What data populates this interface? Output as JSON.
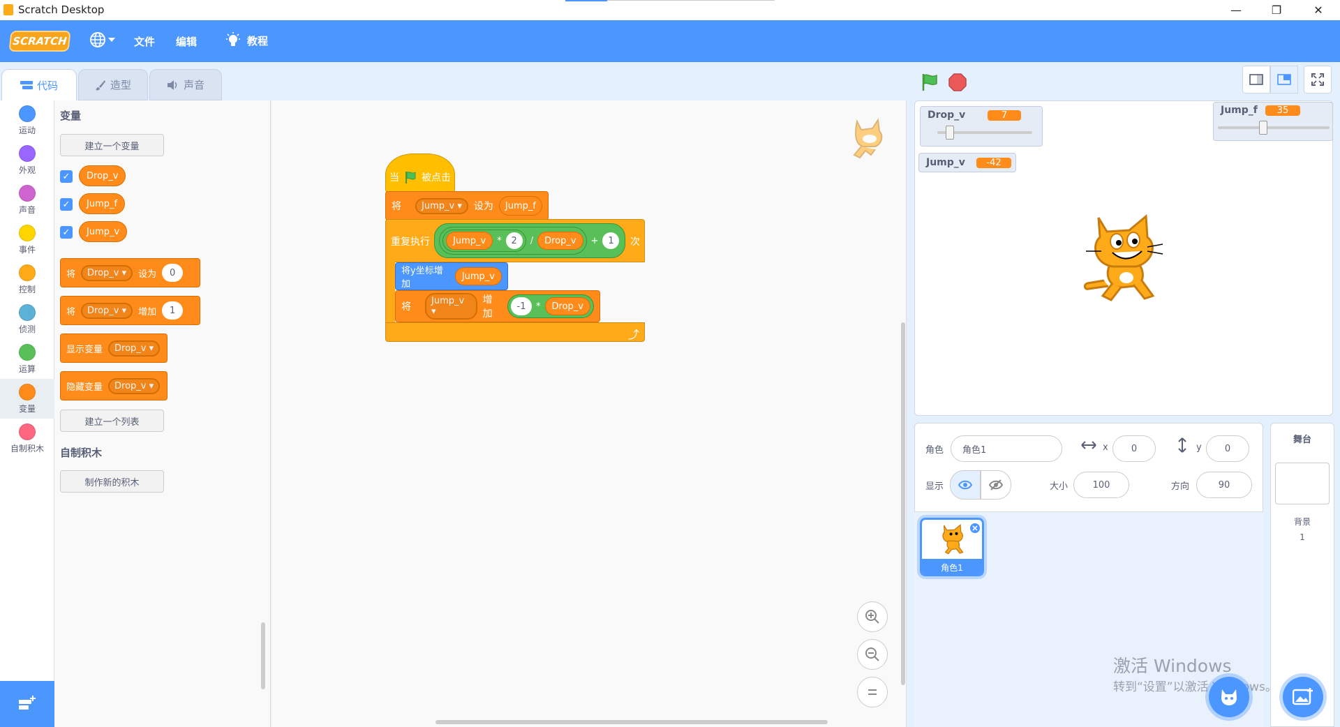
{
  "window": {
    "title": "Scratch Desktop",
    "minimize": "—",
    "maximize": "❐",
    "close": "✕"
  },
  "menubar": {
    "logo": "SCRATCH",
    "language_icon": "globe-icon",
    "file": "文件",
    "edit": "编辑",
    "tutorials": "教程"
  },
  "tabs": [
    {
      "label": "代码",
      "icon": "code-icon",
      "active": true
    },
    {
      "label": "造型",
      "icon": "brush-icon",
      "active": false
    },
    {
      "label": "声音",
      "icon": "speaker-icon",
      "active": false
    }
  ],
  "categories": [
    {
      "label": "运动",
      "color": "#4c97ff"
    },
    {
      "label": "外观",
      "color": "#9966ff"
    },
    {
      "label": "声音",
      "color": "#cf63cf"
    },
    {
      "label": "事件",
      "color": "#ffd500"
    },
    {
      "label": "控制",
      "color": "#ffab19"
    },
    {
      "label": "侦测",
      "color": "#5cb1d6"
    },
    {
      "label": "运算",
      "color": "#59c059"
    },
    {
      "label": "变量",
      "color": "#ff8c1a"
    },
    {
      "label": "自制积木",
      "color": "#ff6680"
    }
  ],
  "palette": {
    "variables_title": "变量",
    "make_variable": "建立一个变量",
    "variables": [
      "Drop_v",
      "Jump_f",
      "Jump_v"
    ],
    "set_block": {
      "verb": "将",
      "var": "Drop_v",
      "op": "设为",
      "value": "0"
    },
    "change_block": {
      "verb": "将",
      "var": "Drop_v",
      "op": "增加",
      "value": "1"
    },
    "show_block": {
      "label": "显示变量",
      "var": "Drop_v"
    },
    "hide_block": {
      "label": "隐藏变量",
      "var": "Drop_v"
    },
    "make_list": "建立一个列表",
    "my_blocks_title": "自制积木",
    "make_block": "制作新的积木"
  },
  "script": {
    "hat": {
      "when": "当",
      "clicked": "被点击"
    },
    "set": {
      "verb": "将",
      "var": "Jump_v",
      "op": "设为",
      "value": "Jump_f"
    },
    "repeat": {
      "label": "重复执行",
      "times": "次",
      "a": "Jump_v",
      "mul": "*",
      "b": "2",
      "div": "/",
      "c": "Drop_v",
      "plus": "+",
      "d": "1"
    },
    "change_y": {
      "label": "将y坐标增加",
      "value": "Jump_v"
    },
    "change": {
      "verb": "将",
      "var": "Jump_v",
      "op": "增加",
      "a": "-1",
      "mul": "*",
      "b": "Drop_v"
    },
    "loop_arrow": "⤴"
  },
  "stage": {
    "monitors": [
      {
        "name": "Drop_v",
        "value": "7",
        "type": "slider",
        "level": 0.1
      },
      {
        "name": "Jump_f",
        "value": "35",
        "type": "slider",
        "level": 0.4
      },
      {
        "name": "Jump_v",
        "value": "-42",
        "type": "normal"
      }
    ]
  },
  "sprite_info": {
    "sprite_label": "角色",
    "sprite_name": "角色1",
    "x_label": "x",
    "x_value": "0",
    "y_label": "y",
    "y_value": "0",
    "show_label": "显示",
    "size_label": "大小",
    "size_value": "100",
    "direction_label": "方向",
    "direction_value": "90"
  },
  "sprite_list": [
    {
      "name": "角色1"
    }
  ],
  "stage_pane": {
    "title": "舞台",
    "backdrop_label": "背景",
    "backdrop_count": "1"
  },
  "watermark": {
    "line1": "激活 Windows",
    "line2": "转到“设置”以激活 Windows。"
  },
  "colors": {
    "accent": "#4c97ff",
    "variables": "#ff8c1a",
    "operators": "#59c059",
    "events": "#ffbf00"
  }
}
